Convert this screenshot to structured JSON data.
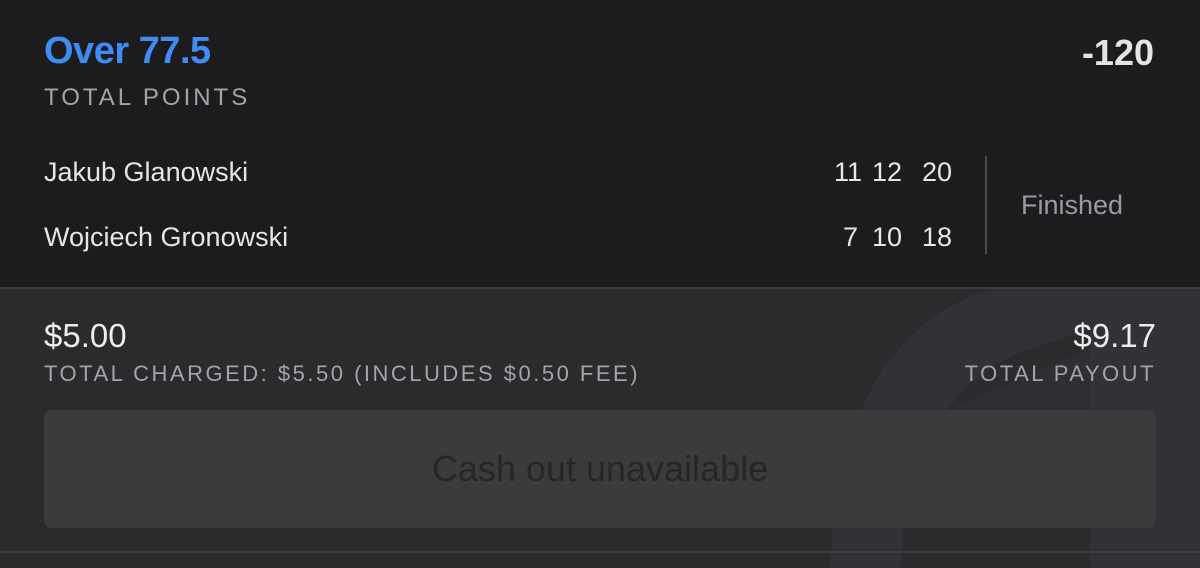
{
  "bet": {
    "selection": "Over 77.5",
    "market": "TOTAL POINTS",
    "odds": "-120"
  },
  "players": [
    {
      "name": "Jakub Glanowski",
      "scores": [
        "11",
        "12",
        "20"
      ]
    },
    {
      "name": "Wojciech Gronowski",
      "scores": [
        "7",
        "10",
        "18"
      ]
    }
  ],
  "status": "Finished",
  "wager": {
    "stake": "$5.00",
    "charged_label": "TOTAL CHARGED: $5.50 (INCLUDES $0.50 FEE)",
    "payout": "$9.17",
    "payout_label": "TOTAL PAYOUT"
  },
  "cashout": {
    "label": "Cash out unavailable"
  },
  "colors": {
    "accent": "#3f8cf5",
    "background": "#1c1c1e",
    "panel": "#2b2b2e",
    "button": "#3b3b3e"
  },
  "icons": {
    "watermark": "brand-shield-icon"
  }
}
